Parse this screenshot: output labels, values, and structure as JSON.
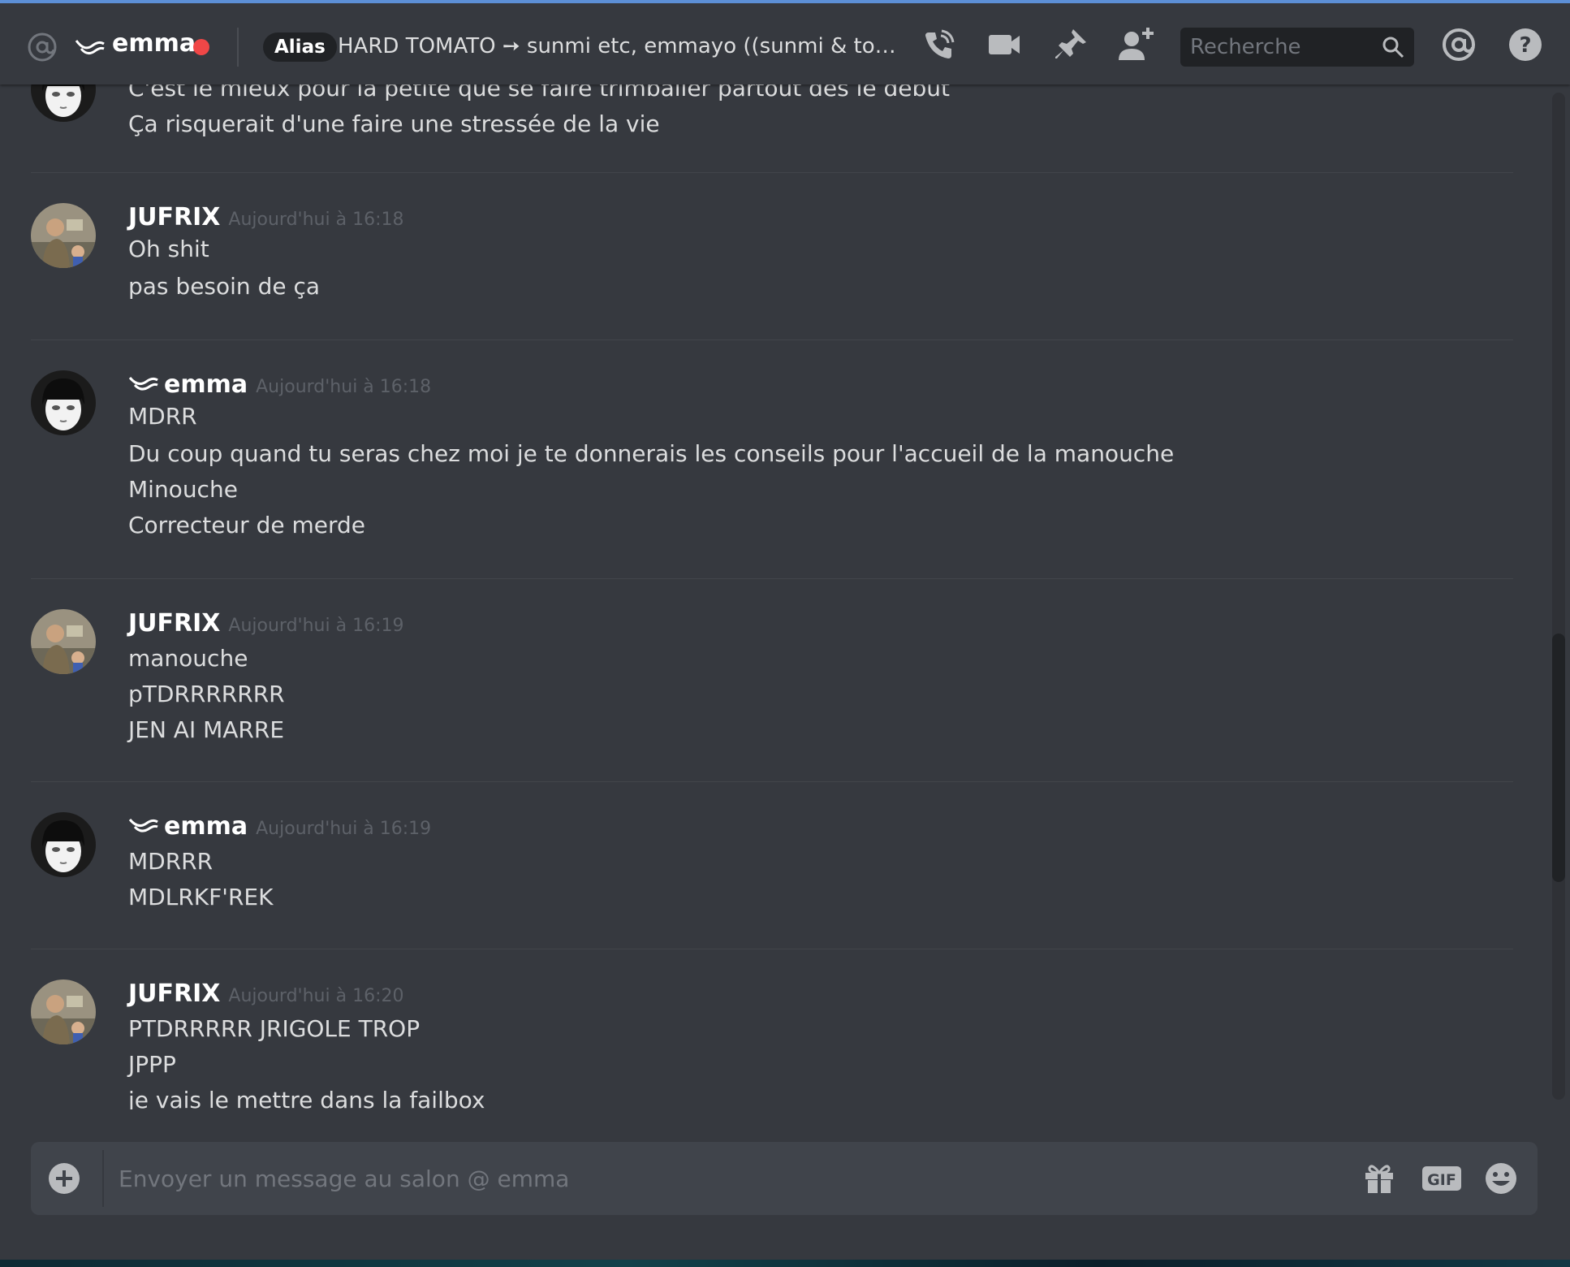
{
  "header": {
    "dm_name": "emma",
    "alias_badge": "Alias",
    "topic": "HARD TOMATO ➙ sunmi etc, emmayo ((sunmi & tomoe)) ...",
    "search_placeholder": "Recherche",
    "status_color": "#f04747",
    "icons": [
      "at-icon",
      "wave-icon",
      "call-icon",
      "video-icon",
      "pin-icon",
      "add-friend-icon",
      "search-icon",
      "mention-icon",
      "help-icon"
    ]
  },
  "messages": [
    {
      "author": "",
      "timestamp": "",
      "lines": [
        "C'est le mieux pour la petite que se faire trimballer partout dès le début",
        "Ça risquerait d'une faire une stressée de la vie"
      ]
    },
    {
      "author": "JUFRIX",
      "timestamp": "Aujourd'hui à 16:18",
      "lines": [
        "Oh shit",
        "pas besoin de ça"
      ]
    },
    {
      "author": "emma",
      "timestamp": "Aujourd'hui à 16:18",
      "lines": [
        "MDRR",
        "Du coup quand tu seras chez moi je te donnerais les conseils pour l'accueil de la manouche",
        "Minouche",
        "Correcteur de merde"
      ]
    },
    {
      "author": "JUFRIX",
      "timestamp": "Aujourd'hui à 16:19",
      "lines": [
        "manouche",
        "pTDRRRRRRR",
        "JEN AI MARRE"
      ]
    },
    {
      "author": "emma",
      "timestamp": "Aujourd'hui à 16:19",
      "lines": [
        "MDRRR",
        "MDLRKF'REK"
      ]
    },
    {
      "author": "JUFRIX",
      "timestamp": "Aujourd'hui à 16:20",
      "lines": [
        "PTDRRRRR JRIGOLE TROP",
        "JPPP",
        "je vais le mettre dans la failbox"
      ]
    }
  ],
  "composer": {
    "placeholder": "Envoyer un message au salon @ emma",
    "icons": [
      "add-attachment-icon",
      "gift-icon",
      "gif-icon",
      "emoji-icon"
    ],
    "gif_label": "GIF"
  },
  "colors": {
    "background": "#36393f",
    "header_badge": "#202225",
    "text": "#dcddde",
    "muted": "#72767d"
  }
}
